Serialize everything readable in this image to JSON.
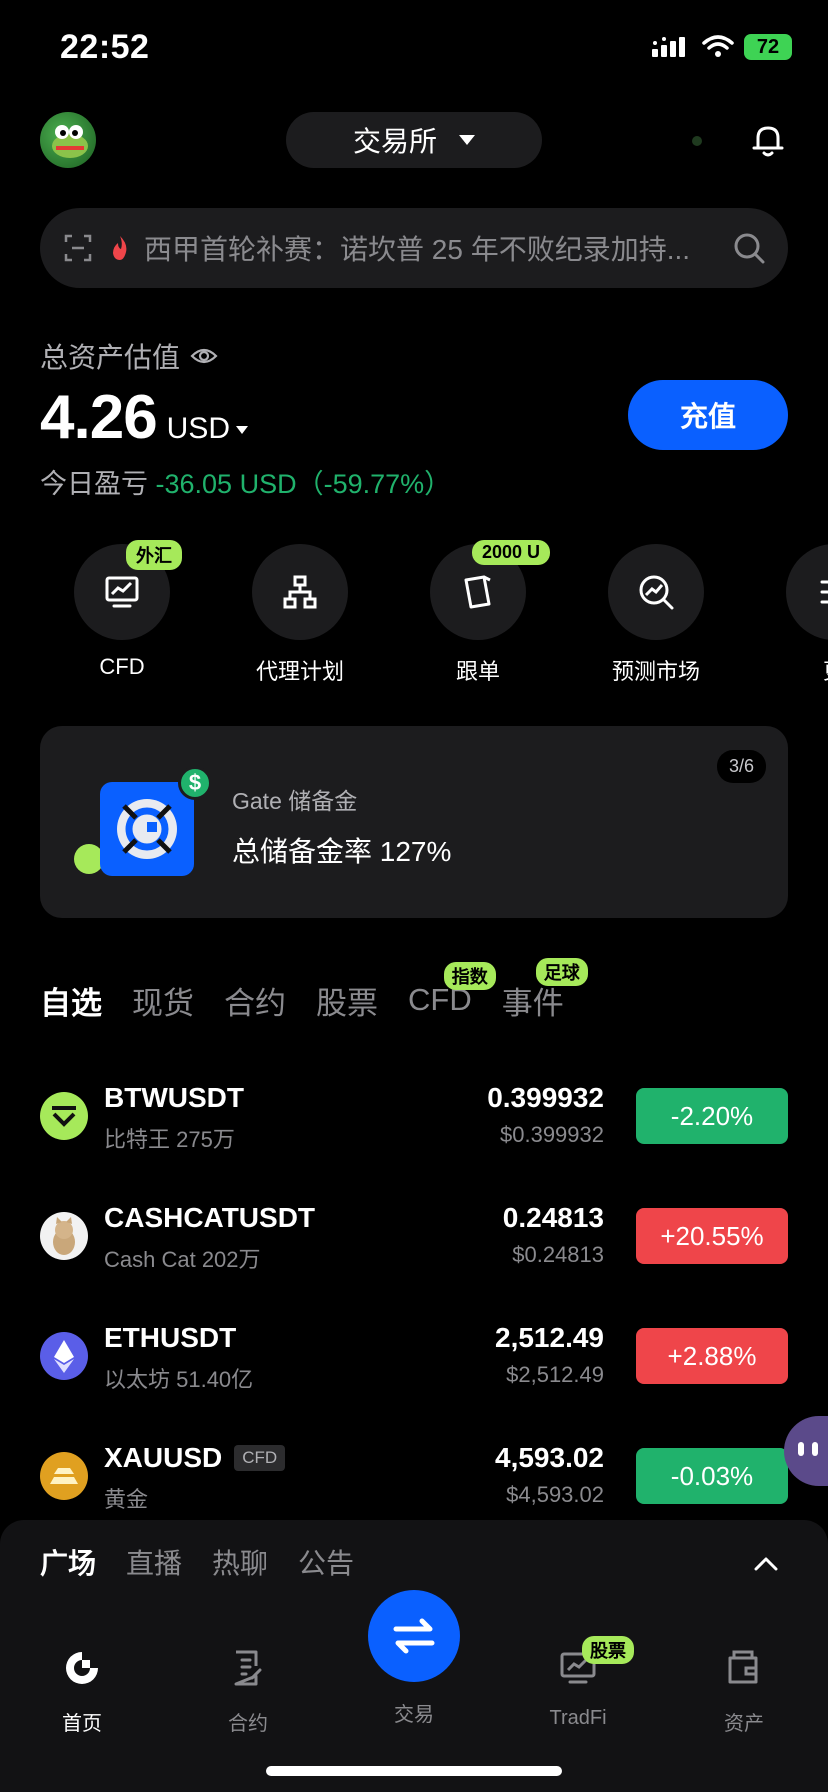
{
  "status_bar": {
    "time": "22:52",
    "battery": "72"
  },
  "header": {
    "exchange_label": "交易所"
  },
  "search": {
    "placeholder": "西甲首轮补赛：诺坎普 25 年不败纪录加持..."
  },
  "assets": {
    "label": "总资产估值",
    "amount": "4.26",
    "currency": "USD",
    "pnl_label": "今日盈亏",
    "pnl_value": "-36.05 USD（-59.77%）",
    "deposit_label": "充值"
  },
  "shortcuts": [
    {
      "label": "CFD",
      "badge": "外汇",
      "icon": "chart-screen-icon"
    },
    {
      "label": "代理计划",
      "badge": "",
      "icon": "org-chart-icon"
    },
    {
      "label": "跟单",
      "badge": "2000 U",
      "icon": "cards-icon"
    },
    {
      "label": "预测市场",
      "badge": "",
      "icon": "trend-search-icon"
    },
    {
      "label": "更",
      "badge": "",
      "icon": "list-icon"
    }
  ],
  "reserve": {
    "page": "3/6",
    "title": "Gate 储备金",
    "text": "总储备金率 127%"
  },
  "market_tabs": [
    {
      "label": "自选",
      "badge": ""
    },
    {
      "label": "现货",
      "badge": ""
    },
    {
      "label": "合约",
      "badge": ""
    },
    {
      "label": "股票",
      "badge": ""
    },
    {
      "label": "CFD",
      "badge": "指数"
    },
    {
      "label": "事件",
      "badge": "足球"
    }
  ],
  "markets": [
    {
      "pair": "BTWUSDT",
      "tag": "",
      "sub": "比特王 275万",
      "price": "0.399932",
      "price_usd": "$0.399932",
      "change": "-2.20%",
      "direction": "down",
      "icon_color": "#a6e95a"
    },
    {
      "pair": "CASHCATUSDT",
      "tag": "",
      "sub": "Cash Cat 202万",
      "price": "0.24813",
      "price_usd": "$0.24813",
      "change": "+20.55%",
      "direction": "up",
      "icon_color": "#f2f2f2"
    },
    {
      "pair": "ETHUSDT",
      "tag": "",
      "sub": "以太坊 51.40亿",
      "price": "2,512.49",
      "price_usd": "$2,512.49",
      "change": "+2.88%",
      "direction": "up",
      "icon_color": "#5a5ee8"
    },
    {
      "pair": "XAUUSD",
      "tag": "CFD",
      "sub": "黄金",
      "price": "4,593.02",
      "price_usd": "$4,593.02",
      "change": "-0.03%",
      "direction": "down",
      "icon_color": "#e0a020"
    }
  ],
  "community_tabs": [
    "广场",
    "直播",
    "热聊",
    "公告"
  ],
  "bottom_nav": {
    "home": "首页",
    "futures": "合约",
    "trade": "交易",
    "tradfi": "TradFi",
    "tradfi_badge": "股票",
    "assets": "资产"
  }
}
